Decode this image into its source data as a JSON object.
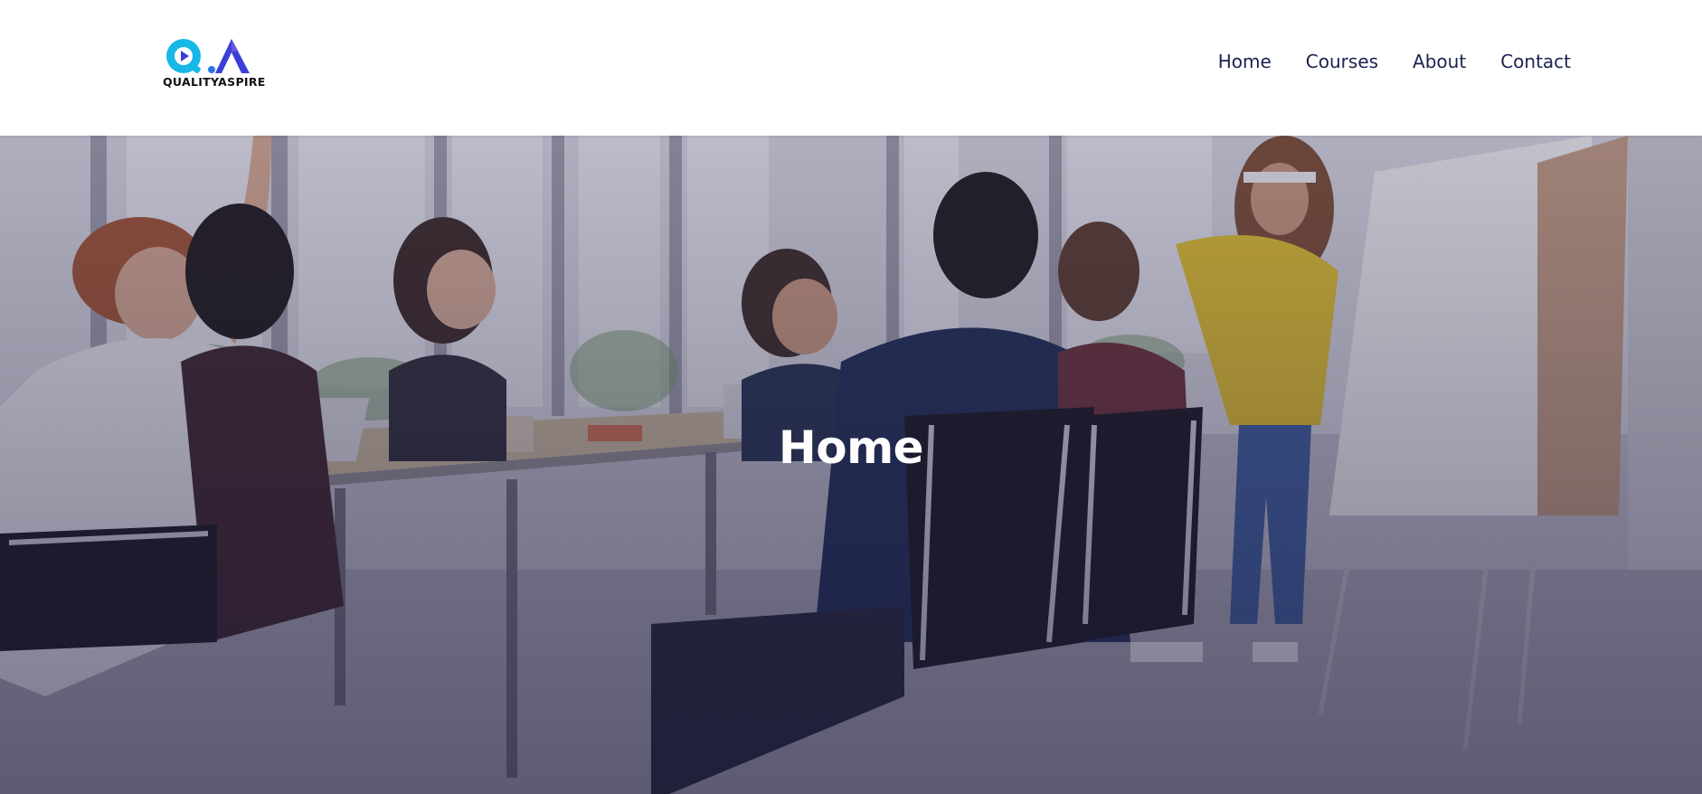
{
  "header": {
    "logo": {
      "monogram": "QA",
      "wordmark": "QUALITYASPIRE",
      "colors": {
        "q": "#17b7e8",
        "a": "#3b3fd6",
        "text": "#111111"
      }
    },
    "nav": [
      {
        "label": "Home"
      },
      {
        "label": "Courses"
      },
      {
        "label": "About"
      },
      {
        "label": "Contact"
      }
    ],
    "nav_color": "#1b2250"
  },
  "hero": {
    "title": "Home",
    "image": "team-meeting-photo",
    "overlay_color": "#2a2850"
  }
}
